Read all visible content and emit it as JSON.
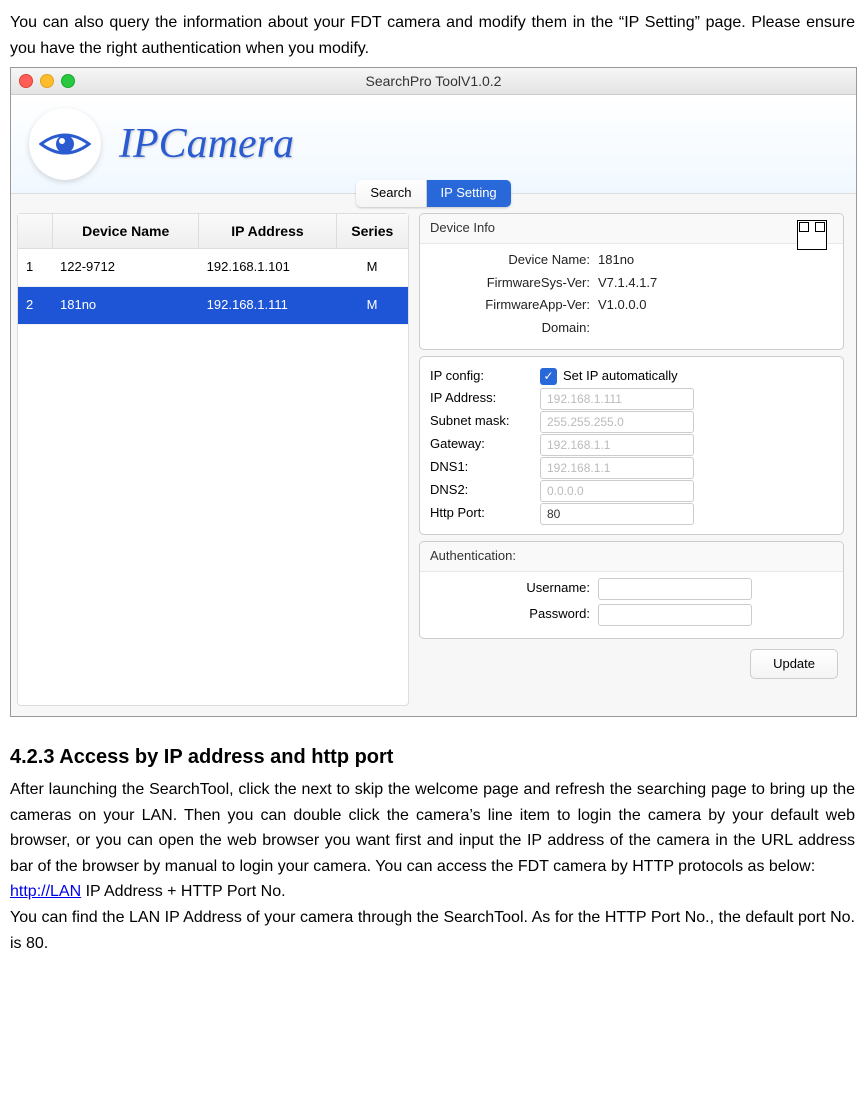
{
  "intro_text": "You can also query the information about your FDT camera and modify them in the “IP Setting” page. Please ensure you have the right authentication when you modify.",
  "window": {
    "title": "SearchPro ToolV1.0.2",
    "logo_text": "IPCamera"
  },
  "tabs": {
    "search": "Search",
    "ipsetting": "IP Setting"
  },
  "table": {
    "headers": {
      "name": "Device Name",
      "ip": "IP Address",
      "series": "Series"
    },
    "rows": [
      {
        "idx": "1",
        "name": "122-9712",
        "ip": "192.168.1.101",
        "series": "M",
        "selected": false
      },
      {
        "idx": "2",
        "name": "181no",
        "ip": "192.168.1.111",
        "series": "M",
        "selected": true
      }
    ]
  },
  "device_info": {
    "title": "Device Info",
    "name_label": "Device Name:",
    "name_val": "181no",
    "fwsys_label": "FirmwareSys-Ver:",
    "fwsys_val": "V7.1.4.1.7",
    "fwapp_label": "FirmwareApp-Ver:",
    "fwapp_val": "V1.0.0.0",
    "domain_label": "Domain:",
    "domain_val": ""
  },
  "ipconfig": {
    "label": "IP config:",
    "auto_label": "Set IP automatically",
    "ip_label": "IP Address:",
    "ip_val": "192.168.1.111",
    "mask_label": "Subnet mask:",
    "mask_val": "255.255.255.0",
    "gw_label": "Gateway:",
    "gw_val": "192.168.1.1",
    "dns1_label": "DNS1:",
    "dns1_val": "192.168.1.1",
    "dns2_label": "DNS2:",
    "dns2_val": "0.0.0.0",
    "port_label": "Http Port:",
    "port_val": "80"
  },
  "auth": {
    "title": "Authentication:",
    "user_label": "Username:",
    "pass_label": "Password:"
  },
  "update_btn": "Update",
  "section": {
    "heading": "4.2.3 Access by IP address and http port",
    "body1": "After launching the SearchTool, click the next to skip the welcome page and refresh the searching page to bring up the cameras on your LAN. Then you can double click the camera’s line item to login the camera by your default web browser, or you can open the web browser you want first and input the IP address of the camera in the URL address bar of the browser by manual to login your camera. You can access the FDT camera by HTTP protocols as below:",
    "link_text": "http://LAN",
    "body2_after_link": " IP Address + HTTP Port No.",
    "body3": "You can find the LAN IP Address of your camera through the SearchTool. As for the HTTP Port No., the default port No. is 80."
  }
}
